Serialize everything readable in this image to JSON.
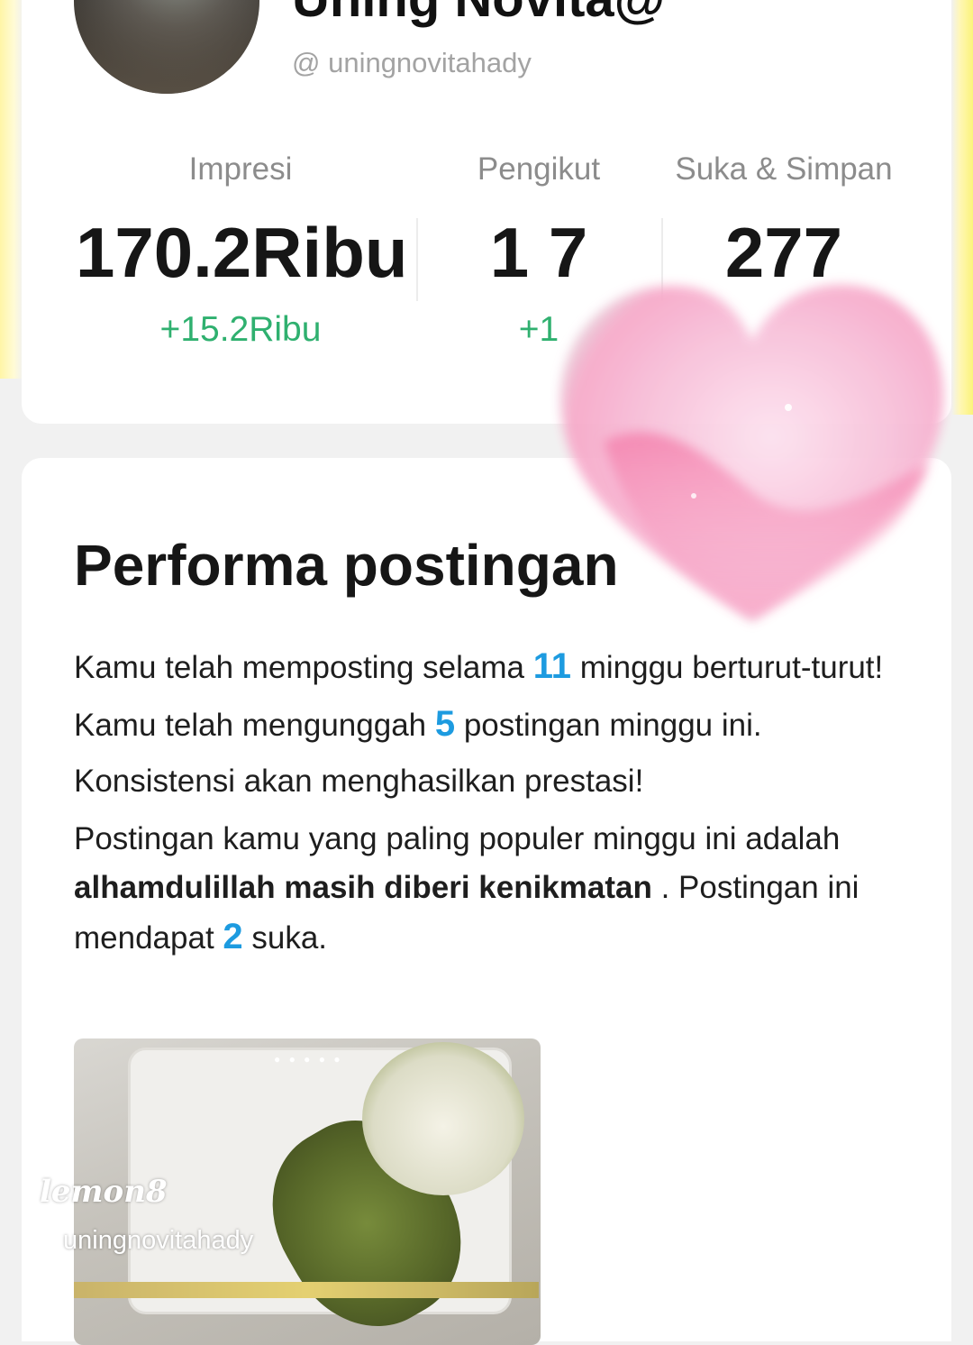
{
  "profile": {
    "name": "Uning Novita@",
    "handle": "@ uningnovitahady"
  },
  "stats": [
    {
      "label": "Impresi",
      "value": "170.2Ribu",
      "delta": "+15.2Ribu"
    },
    {
      "label": "Pengikut",
      "value": "1 7",
      "delta": "+1"
    },
    {
      "label": "Suka & Simpan",
      "value": "277",
      "delta": ""
    }
  ],
  "performance": {
    "title": "Performa postingan",
    "p1": {
      "a": "Kamu telah memposting selama ",
      "weeks": "11",
      "b": " minggu berturut-turut! Kamu telah mengunggah ",
      "posts": "5",
      "c": " postingan minggu ini. Konsistensi akan menghasilkan prestasi!"
    },
    "p2": {
      "a": "Postingan kamu yang paling populer minggu ini adalah ",
      "post_title": "alhamdulillah masih diberi kenikmatan",
      "b": " . Postingan ini mendapat ",
      "likes": "2",
      "c": " suka."
    }
  },
  "thumbnail": {
    "watermark_logo": "lemon8",
    "watermark_handle": "uningnovitahady"
  },
  "colors": {
    "accent_blue": "#1d9be0",
    "positive_green": "#2fb06f",
    "yellow_edge": "#fbf37a"
  }
}
